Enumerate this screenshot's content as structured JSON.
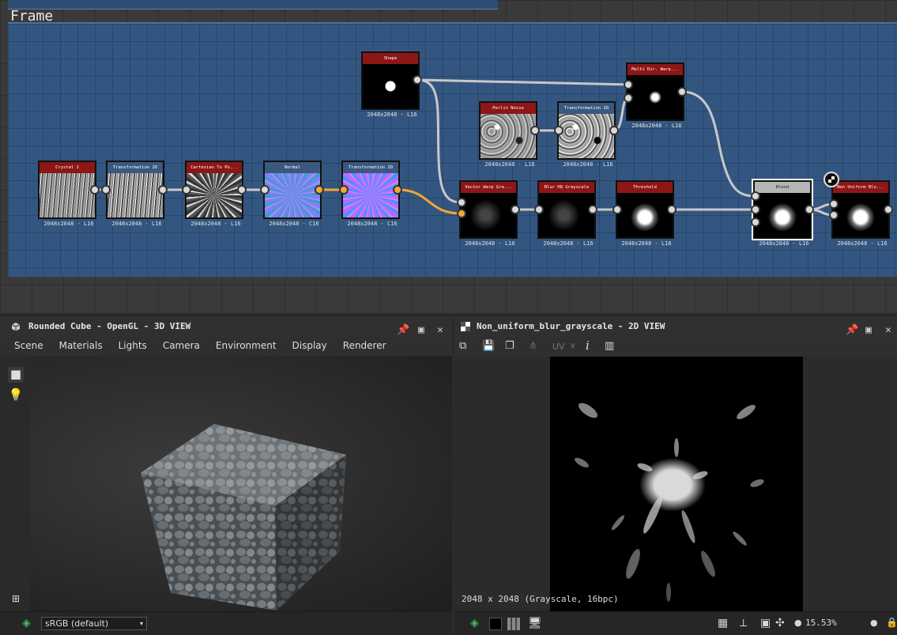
{
  "graph": {
    "frame_label": "Frame",
    "nodes": [
      {
        "title": "Crystal 2",
        "caption": "2048x2048 - L16"
      },
      {
        "title": "Transformation 2D",
        "caption": "2048x2048 - L16"
      },
      {
        "title": "Cartesian To Po...",
        "caption": "2048x2048 - L16"
      },
      {
        "title": "Normal",
        "caption": "2048x2048 - C16"
      },
      {
        "title": "Transformation 2D",
        "caption": "2048x2048 - C16"
      },
      {
        "title": "Shape",
        "caption": "2048x2048 - L16"
      },
      {
        "title": "Perlin Noise",
        "caption": "2048x2048 - L16"
      },
      {
        "title": "Transformation 2D",
        "caption": "2048x2048 - L16"
      },
      {
        "title": "Multi Dir. Warp...",
        "caption": "2048x2048 - L16"
      },
      {
        "title": "Vector Warp Gra...",
        "caption": "2048x2048 - L16"
      },
      {
        "title": "Blur HQ Grayscale",
        "caption": "2048x2048 - L16"
      },
      {
        "title": "Threshold",
        "caption": "2048x2048 - L16"
      },
      {
        "title": "Blend",
        "caption": "2048x2048 - L16"
      },
      {
        "title": "Non Uniform Blu...",
        "caption": "2048x2048 - L16"
      }
    ]
  },
  "view3d": {
    "title": "Rounded Cube - OpenGL - 3D VIEW",
    "menu": [
      "Scene",
      "Materials",
      "Lights",
      "Camera",
      "Environment",
      "Display",
      "Renderer"
    ],
    "colorspace": "sRGB (default)"
  },
  "view2d": {
    "title": "Non_uniform_blur_grayscale - 2D VIEW",
    "uv_label": "UV",
    "info_label": "i",
    "image_info": "2048 x 2048 (Grayscale, 16bpc)",
    "zoom": "15.53%"
  },
  "icons": [
    "cube-icon",
    "pin-icon",
    "maximize-icon",
    "close-icon",
    "camera-icon",
    "light-bulb-icon",
    "tree-icon",
    "layers-icon",
    "save-icon",
    "copy-icon",
    "share-icon",
    "histogram-icon",
    "grid-icon",
    "eyedropper-icon",
    "fit-icon",
    "move-icon",
    "lock-icon"
  ]
}
